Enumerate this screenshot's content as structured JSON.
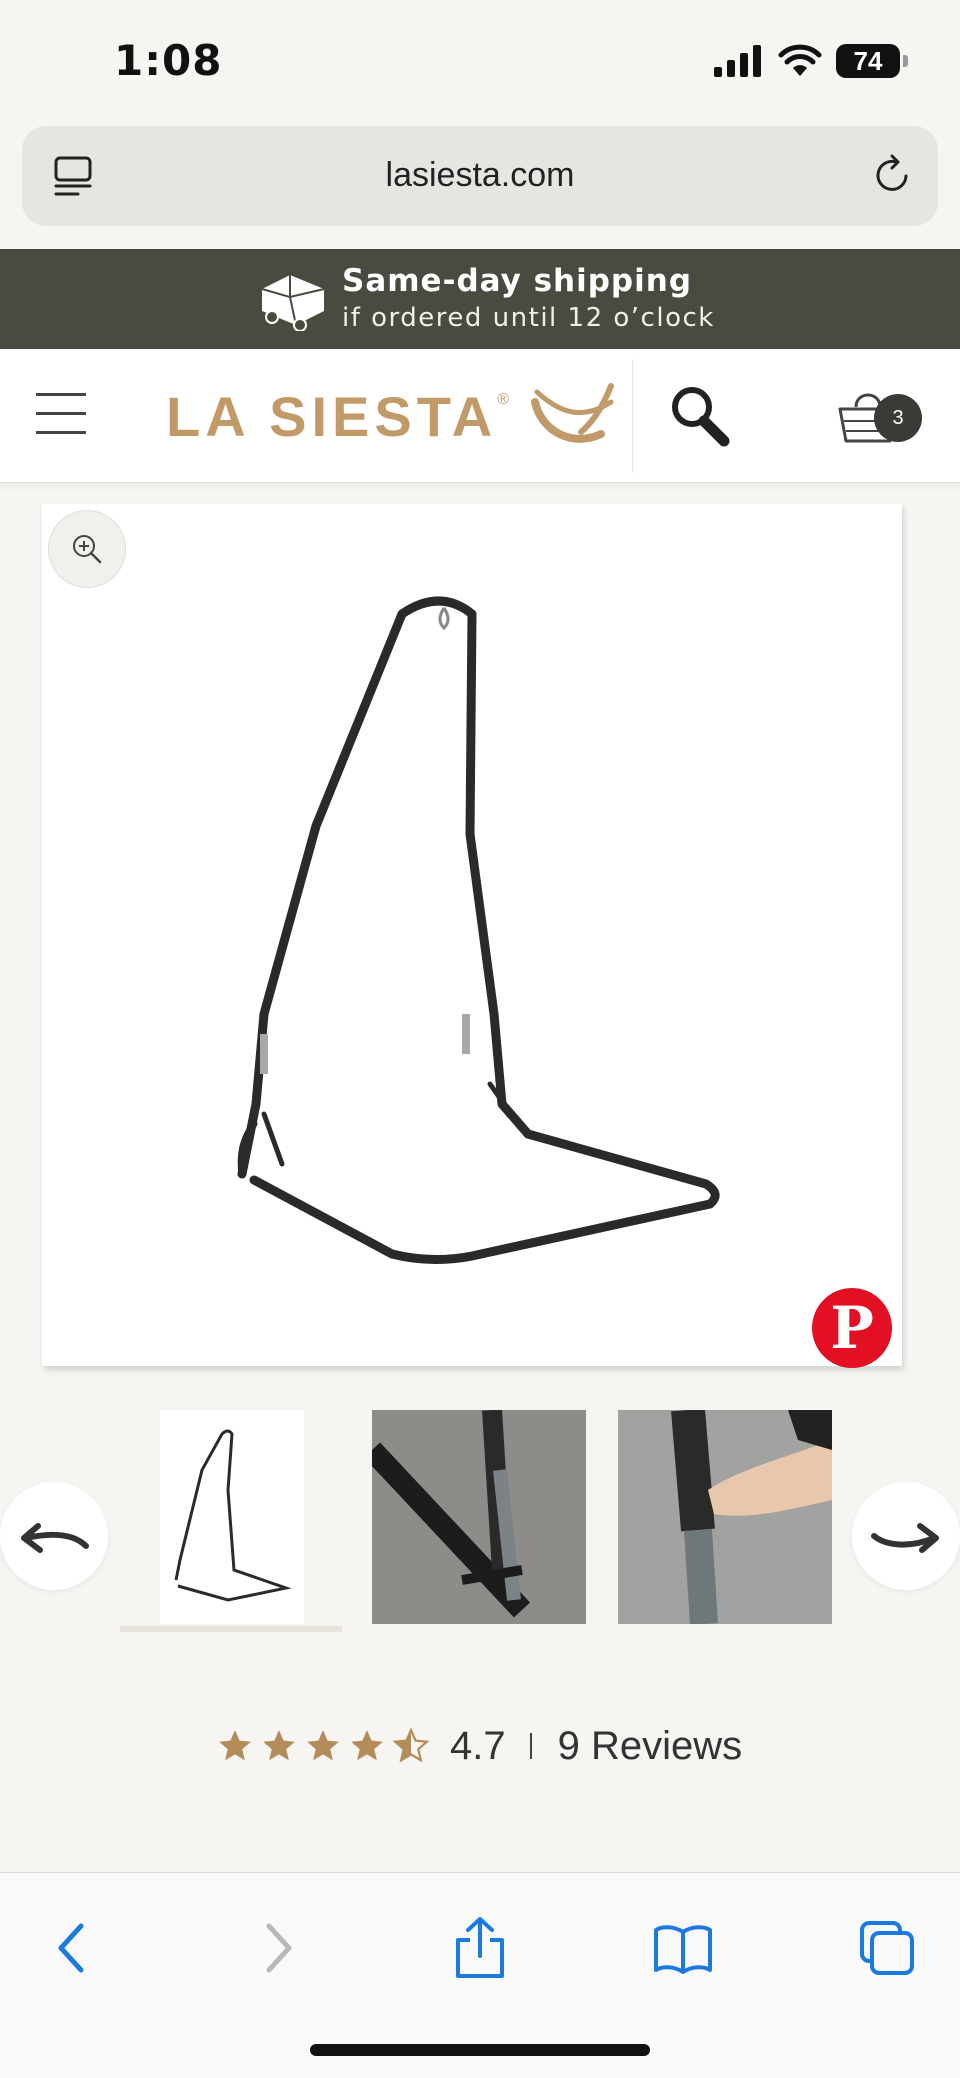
{
  "status_bar": {
    "time": "1:08",
    "battery": "74"
  },
  "browser": {
    "url": "lasiesta.com"
  },
  "banner": {
    "title": "Same-day shipping",
    "subtitle": "if ordered until 12 o’clock"
  },
  "header": {
    "logo_text": "LA SIESTA",
    "logo_mark": "®",
    "cart_count": "3"
  },
  "gallery": {
    "thumbnails": [
      "hammock-chair-stand",
      "stand-base-closeup",
      "stand-pole-adjust"
    ]
  },
  "rating": {
    "value": "4.7",
    "reviews": "9 Reviews",
    "stars": 4.5
  },
  "colors": {
    "brand": "#c29a6a",
    "banner_bg": "#4a4a40",
    "link_blue": "#1a7ae0",
    "pinterest": "#e30f23"
  },
  "icons": [
    "tabs-icon",
    "reload-icon",
    "truck-icon",
    "menu-icon",
    "search-icon",
    "cart-icon",
    "zoom-icon",
    "pinterest-icon",
    "arrow-left-icon",
    "arrow-right-icon",
    "star-icon",
    "back-icon",
    "forward-icon",
    "share-icon",
    "bookmarks-icon",
    "tabs-overview-icon"
  ]
}
